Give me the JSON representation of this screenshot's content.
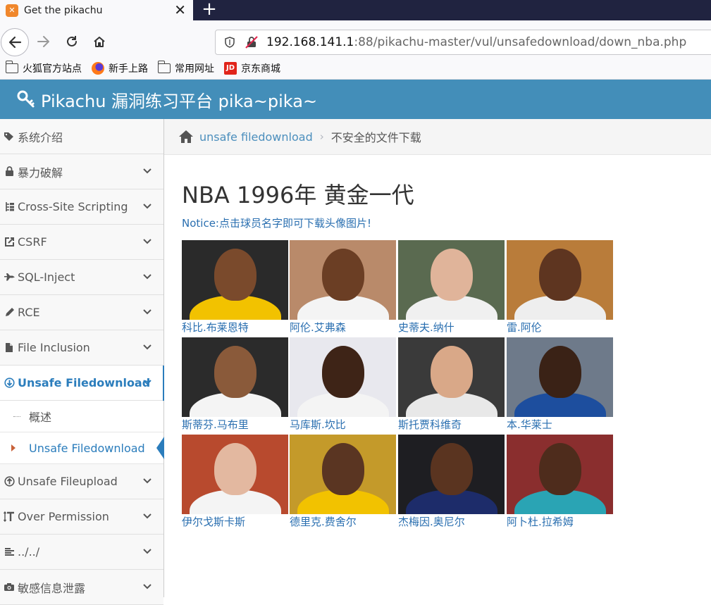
{
  "browser": {
    "tab_title": "Get the pikachu",
    "tab_favicon": "XAMPP",
    "close_glyph": "✕",
    "newtab_glyph": "+",
    "url_host": "192.168.141.1",
    "url_rest": ":88/pikachu-master/vul/unsafedownload/down_nba.php",
    "bookmarks": [
      "火狐官方站点",
      "新手上路",
      "常用网址",
      "京东商城"
    ],
    "jd_logo": "JD",
    "icons": [
      "back-arrow-icon",
      "forward-arrow-icon",
      "reload-icon",
      "home-icon",
      "shield-icon",
      "insecure-lock-icon"
    ]
  },
  "site": {
    "title": "Pikachu 漏洞练习平台 pika~pika~"
  },
  "sidebar": {
    "items": [
      {
        "label": "系统介绍",
        "icon": "tags-icon"
      },
      {
        "label": "暴力破解",
        "icon": "lock-icon"
      },
      {
        "label": "Cross-Site Scripting",
        "icon": "sitemap-icon"
      },
      {
        "label": "CSRF",
        "icon": "share-icon"
      },
      {
        "label": "SQL-Inject",
        "icon": "fighter-jet-icon"
      },
      {
        "label": "RCE",
        "icon": "pencil-icon"
      },
      {
        "label": "File Inclusion",
        "icon": "file-icon"
      },
      {
        "label": "Unsafe Filedownload",
        "icon": "download-icon"
      },
      {
        "label": "Unsafe Fileupload",
        "icon": "upload-icon"
      },
      {
        "label": "Over Permission",
        "icon": "text-height-icon"
      },
      {
        "label": "../../",
        "icon": "align-left-icon"
      },
      {
        "label": "敏感信息泄露",
        "icon": "camera-icon"
      }
    ],
    "sub_items": [
      {
        "label": "概述"
      },
      {
        "label": "Unsafe Filedownload"
      }
    ]
  },
  "breadcrumb": {
    "link": "unsafe filedownload",
    "sep": "›",
    "current": "不安全的文件下载"
  },
  "main": {
    "heading": "NBA 1996年 黄金一代",
    "notice": "Notice:点击球员名字即可下载头像图片!",
    "players": [
      {
        "name": "科比.布莱恩特",
        "bg": "#2a2a2a",
        "skin": "#7a4a2c",
        "jersey": "#f2c200"
      },
      {
        "name": "阿伦.艾弗森",
        "bg": "#b98a6a",
        "skin": "#6b3e24",
        "jersey": "#f4f4f4"
      },
      {
        "name": "史蒂夫.纳什",
        "bg": "#5a6a50",
        "skin": "#e0b49a",
        "jersey": "#f0f0f0"
      },
      {
        "name": "雷.阿伦",
        "bg": "#b97c3a",
        "skin": "#5e3520",
        "jersey": "#eeeeee"
      },
      {
        "name": "斯蒂芬.马布里",
        "bg": "#2b2b2b",
        "skin": "#8a5a3a",
        "jersey": "#f4f4f4"
      },
      {
        "name": "马库斯.坎比",
        "bg": "#e8e8ee",
        "skin": "#3e2417",
        "jersey": "#f4f4f4"
      },
      {
        "name": "斯托贾科维奇",
        "bg": "#3a3a3a",
        "skin": "#d9a888",
        "jersey": "#e8e8e8"
      },
      {
        "name": "本.华莱士",
        "bg": "#6e7a8a",
        "skin": "#3a2216",
        "jersey": "#1d4e9e"
      },
      {
        "name": "伊尔戈斯卡斯",
        "bg": "#b84a2e",
        "skin": "#e3b8a0",
        "jersey": "#f4f4f4"
      },
      {
        "name": "德里克.费舍尔",
        "bg": "#c49a2a",
        "skin": "#5a3522",
        "jersey": "#f2c200"
      },
      {
        "name": "杰梅因.奥尼尔",
        "bg": "#1e1e22",
        "skin": "#5a3420",
        "jersey": "#1d2c6a"
      },
      {
        "name": "阿卜杜.拉希姆",
        "bg": "#8a2e2e",
        "skin": "#4e2c1c",
        "jersey": "#2aa4b4"
      }
    ]
  }
}
